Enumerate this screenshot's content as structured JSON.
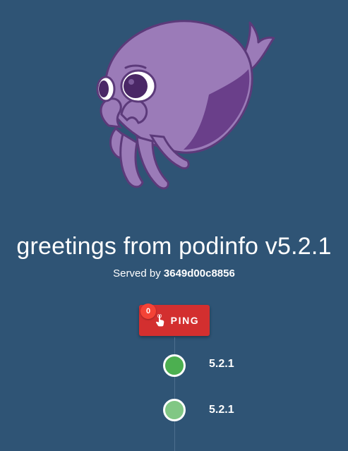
{
  "header": {
    "title": "greetings from podinfo v5.2.1",
    "served_by_prefix": "Served by",
    "hostname": "3649d00c8856"
  },
  "ping": {
    "label": "PING",
    "count": "0",
    "icon": "touch-hand-icon"
  },
  "mascot": {
    "icon": "octopus-mascot"
  },
  "timeline": {
    "items": [
      {
        "label": "5.2.1",
        "color": "#4caf50"
      },
      {
        "label": "5.2.1",
        "color": "#81c784"
      }
    ]
  },
  "colors": {
    "background": "#2f5475",
    "button": "#d32f2f",
    "badge": "#f44336",
    "octopus_body": "#9b7bb8",
    "octopus_outline": "#5c3a7a"
  }
}
